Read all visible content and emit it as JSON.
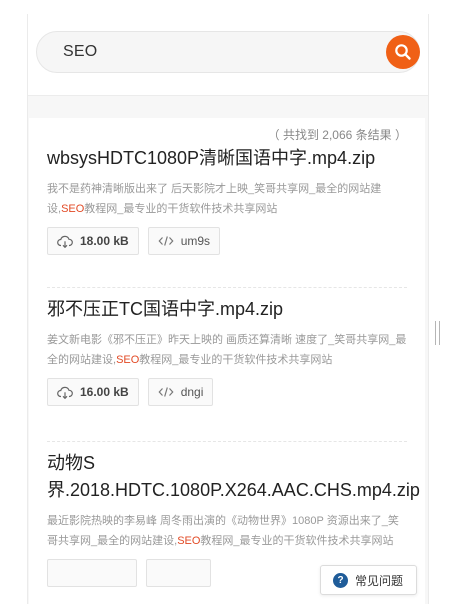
{
  "search": {
    "query": "SEO",
    "button_icon": "search-icon"
  },
  "results_count": "（ 共找到 2,066 条结果 ）",
  "results": [
    {
      "title": "wbsysHDTC1080P清晰国语中字.mp4.zip",
      "desc_before": "我不是药神清晰版出来了 后天影院才上映_笑哥共享网_最全的网站建设,",
      "desc_highlight": "SEO",
      "desc_after": "教程网_最专业的干货软件技术共享网站",
      "size": "18.00 kB",
      "code": "um9s"
    },
    {
      "title": "邪不压正TC国语中字.mp4.zip",
      "desc_before": "姜文新电影《邪不压正》昨天上映的 画质还算清晰 速度了_笑哥共享网_最全的网站建设,",
      "desc_highlight": "SEO",
      "desc_after": "教程网_最专业的干货软件技术共享网站",
      "size": "16.00 kB",
      "code": "dngi"
    },
    {
      "title": "动物S界.2018.HDTC.1080P.X264.AAC.CHS.mp4.zip",
      "desc_before": "最近影院热映的李易峰 周冬雨出演的《动物世界》1080P 资源出来了_笑哥共享网_最全的网站建设,",
      "desc_highlight": "SEO",
      "desc_after": "教程网_最专业的干货软件技术共享网站",
      "size": "",
      "code": ""
    }
  ],
  "help_button": {
    "label": "常见问题",
    "icon": "question-icon"
  },
  "colors": {
    "accent": "#f06016",
    "highlight": "#e24a25",
    "help_icon": "#1f5c99"
  }
}
